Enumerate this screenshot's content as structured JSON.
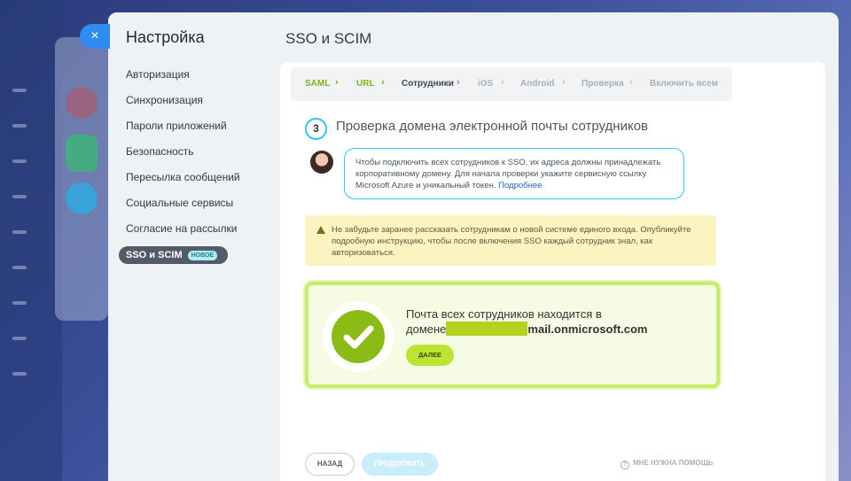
{
  "sidebar": {
    "title": "Настройка",
    "items": [
      {
        "label": "Авторизация"
      },
      {
        "label": "Синхронизация"
      },
      {
        "label": "Пароли приложений"
      },
      {
        "label": "Безопасность"
      },
      {
        "label": "Пересылка сообщений"
      },
      {
        "label": "Социальные сервисы"
      },
      {
        "label": "Согласие на рассылки"
      },
      {
        "label": "SSO и SCIM",
        "badge": "НОВОЕ",
        "active": true
      }
    ]
  },
  "close_icon": "×",
  "page_title": "SSO и SCIM",
  "stepper": {
    "steps": [
      {
        "label": "SAML",
        "state": "done"
      },
      {
        "label": "URL",
        "state": "done"
      },
      {
        "label": "Сотрудники",
        "state": "current"
      },
      {
        "label": "iOS",
        "state": "todo"
      },
      {
        "label": "Android",
        "state": "todo"
      },
      {
        "label": "Проверка",
        "state": "todo"
      },
      {
        "label": "Включить всем",
        "state": "todo"
      }
    ],
    "separator": "›"
  },
  "step": {
    "number": "3",
    "heading": "Проверка домена электронной почты сотрудников"
  },
  "bubble": {
    "text": "Чтобы подключить всех сотрудников к SSO, их адреса должны принадлежать корпоративному домену. Для начала проверки укажите сервисную ссылку Microsoft Azure и уникальный токен.",
    "link": "Подробнее"
  },
  "warning": {
    "text": "Не забудьте заранее рассказать сотрудникам о новой системе единого входа. Опубликуйте подробную инструкцию, чтобы после включения SSO каждый сотрудник знал, как авторизоваться."
  },
  "success": {
    "line1": "Почта всех сотрудников находится в",
    "prefix": "домене",
    "suffix": "mail.onmicrosoft.com",
    "next_label": "ДАЛЕЕ"
  },
  "footer": {
    "back_label": "НАЗАД",
    "continue_label": "ПРОДОЛЖИТЬ",
    "help_label": "МНЕ НУЖНА ПОМОЩЬ",
    "help_icon": "?"
  },
  "colors": {
    "accent": "#2fc6f6",
    "success": "#8dbb16",
    "done_step": "#7fb21a"
  }
}
